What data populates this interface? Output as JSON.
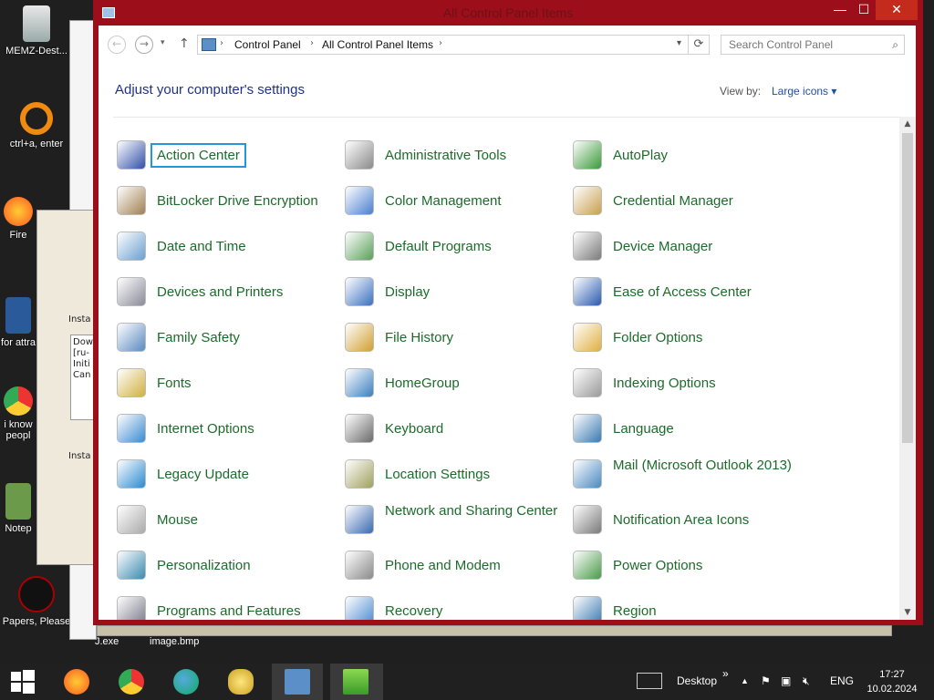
{
  "desktop": {
    "icons": [
      {
        "label": "MEMZ-Dest..."
      },
      {
        "label": "ctrl+a, enter"
      },
      {
        "label": "Fire"
      },
      {
        "label": "for attra"
      },
      {
        "label": "i know peopl"
      },
      {
        "label": "Notep"
      },
      {
        "label": "Papers, Please"
      }
    ],
    "background_labels": [
      "J.exe",
      "image.bmp"
    ],
    "bg_installer_text": [
      "Insta",
      "Dow",
      "[ru-",
      "Initi",
      "Can",
      "Insta"
    ]
  },
  "window": {
    "title": "All Control Panel Items",
    "controls": {
      "minimize": "—",
      "maximize": "☐",
      "close": "✕"
    },
    "address": {
      "crumbs": [
        "Control Panel",
        "All Control Panel Items"
      ],
      "search_placeholder": "Search Control Panel"
    },
    "heading": "Adjust your computer's settings",
    "view_by_label": "View by:",
    "view_by_value": "Large icons ▾",
    "items": [
      {
        "label": "Action Center",
        "icon": "flag-icon",
        "color": "#2f4fa8"
      },
      {
        "label": "Administrative Tools",
        "icon": "tools-icon",
        "color": "#8a8a8a"
      },
      {
        "label": "AutoPlay",
        "icon": "autoplay-icon",
        "color": "#3a9a3a"
      },
      {
        "label": "BitLocker Drive Encryption",
        "icon": "bitlocker-icon",
        "color": "#a08050"
      },
      {
        "label": "Color Management",
        "icon": "color-icon",
        "color": "#4a7fd0"
      },
      {
        "label": "Credential Manager",
        "icon": "credential-icon",
        "color": "#c8a050"
      },
      {
        "label": "Date and Time",
        "icon": "clock-icon",
        "color": "#6a9fd0"
      },
      {
        "label": "Default Programs",
        "icon": "default-programs-icon",
        "color": "#5aa05a"
      },
      {
        "label": "Device Manager",
        "icon": "device-manager-icon",
        "color": "#7a7a7a"
      },
      {
        "label": "Devices and Printers",
        "icon": "printer-icon",
        "color": "#8a8a9a"
      },
      {
        "label": "Display",
        "icon": "display-icon",
        "color": "#3a70c0"
      },
      {
        "label": "Ease of Access Center",
        "icon": "ease-icon",
        "color": "#2a5ab0"
      },
      {
        "label": "Family Safety",
        "icon": "family-icon",
        "color": "#5a8ac0"
      },
      {
        "label": "File History",
        "icon": "file-history-icon",
        "color": "#d0a030"
      },
      {
        "label": "Folder Options",
        "icon": "folder-icon",
        "color": "#e0b040"
      },
      {
        "label": "Fonts",
        "icon": "fonts-icon",
        "color": "#d0b040"
      },
      {
        "label": "HomeGroup",
        "icon": "homegroup-icon",
        "color": "#3a80c0"
      },
      {
        "label": "Indexing Options",
        "icon": "indexing-icon",
        "color": "#9a9a9a"
      },
      {
        "label": "Internet Options",
        "icon": "internet-icon",
        "color": "#3a8ad0"
      },
      {
        "label": "Keyboard",
        "icon": "keyboard-icon",
        "color": "#6a6a6a"
      },
      {
        "label": "Language",
        "icon": "language-icon",
        "color": "#3a7ab0"
      },
      {
        "label": "Legacy Update",
        "icon": "update-icon",
        "color": "#2a8ad0"
      },
      {
        "label": "Location Settings",
        "icon": "location-icon",
        "color": "#a0a060"
      },
      {
        "label": "Mail (Microsoft Outlook 2013)",
        "icon": "mail-icon",
        "color": "#4a8ac0"
      },
      {
        "label": "Mouse",
        "icon": "mouse-icon",
        "color": "#aaaaaa"
      },
      {
        "label": "Network and Sharing Center",
        "icon": "network-icon",
        "color": "#3a6ab0"
      },
      {
        "label": "Notification Area Icons",
        "icon": "notification-icon",
        "color": "#7a7a7a"
      },
      {
        "label": "Personalization",
        "icon": "personalization-icon",
        "color": "#3a8ab0"
      },
      {
        "label": "Phone and Modem",
        "icon": "phone-icon",
        "color": "#8a8a8a"
      },
      {
        "label": "Power Options",
        "icon": "power-icon",
        "color": "#4a9a4a"
      },
      {
        "label": "Programs and Features",
        "icon": "programs-icon",
        "color": "#7a7a8a"
      },
      {
        "label": "Recovery",
        "icon": "recovery-icon",
        "color": "#4a8ad0"
      },
      {
        "label": "Region",
        "icon": "region-icon",
        "color": "#3a7ab0"
      }
    ]
  },
  "taskbar": {
    "start_icon": "windows-icon",
    "apps": [
      "firefox-icon",
      "chrome-icon",
      "edge-icon",
      "explorer-icon",
      "control-panel-icon",
      "installer-icon"
    ],
    "desktop_label": "Desktop",
    "chevron": "»",
    "language": "ENG",
    "time": "17:27",
    "date": "10.02.2024"
  },
  "colors": {
    "window_frame": "#9c0f1a",
    "close_button": "#c42b1c",
    "link_green": "#1d6b2b",
    "heading_blue": "#1e3287",
    "focus_outline": "#2596d9"
  }
}
